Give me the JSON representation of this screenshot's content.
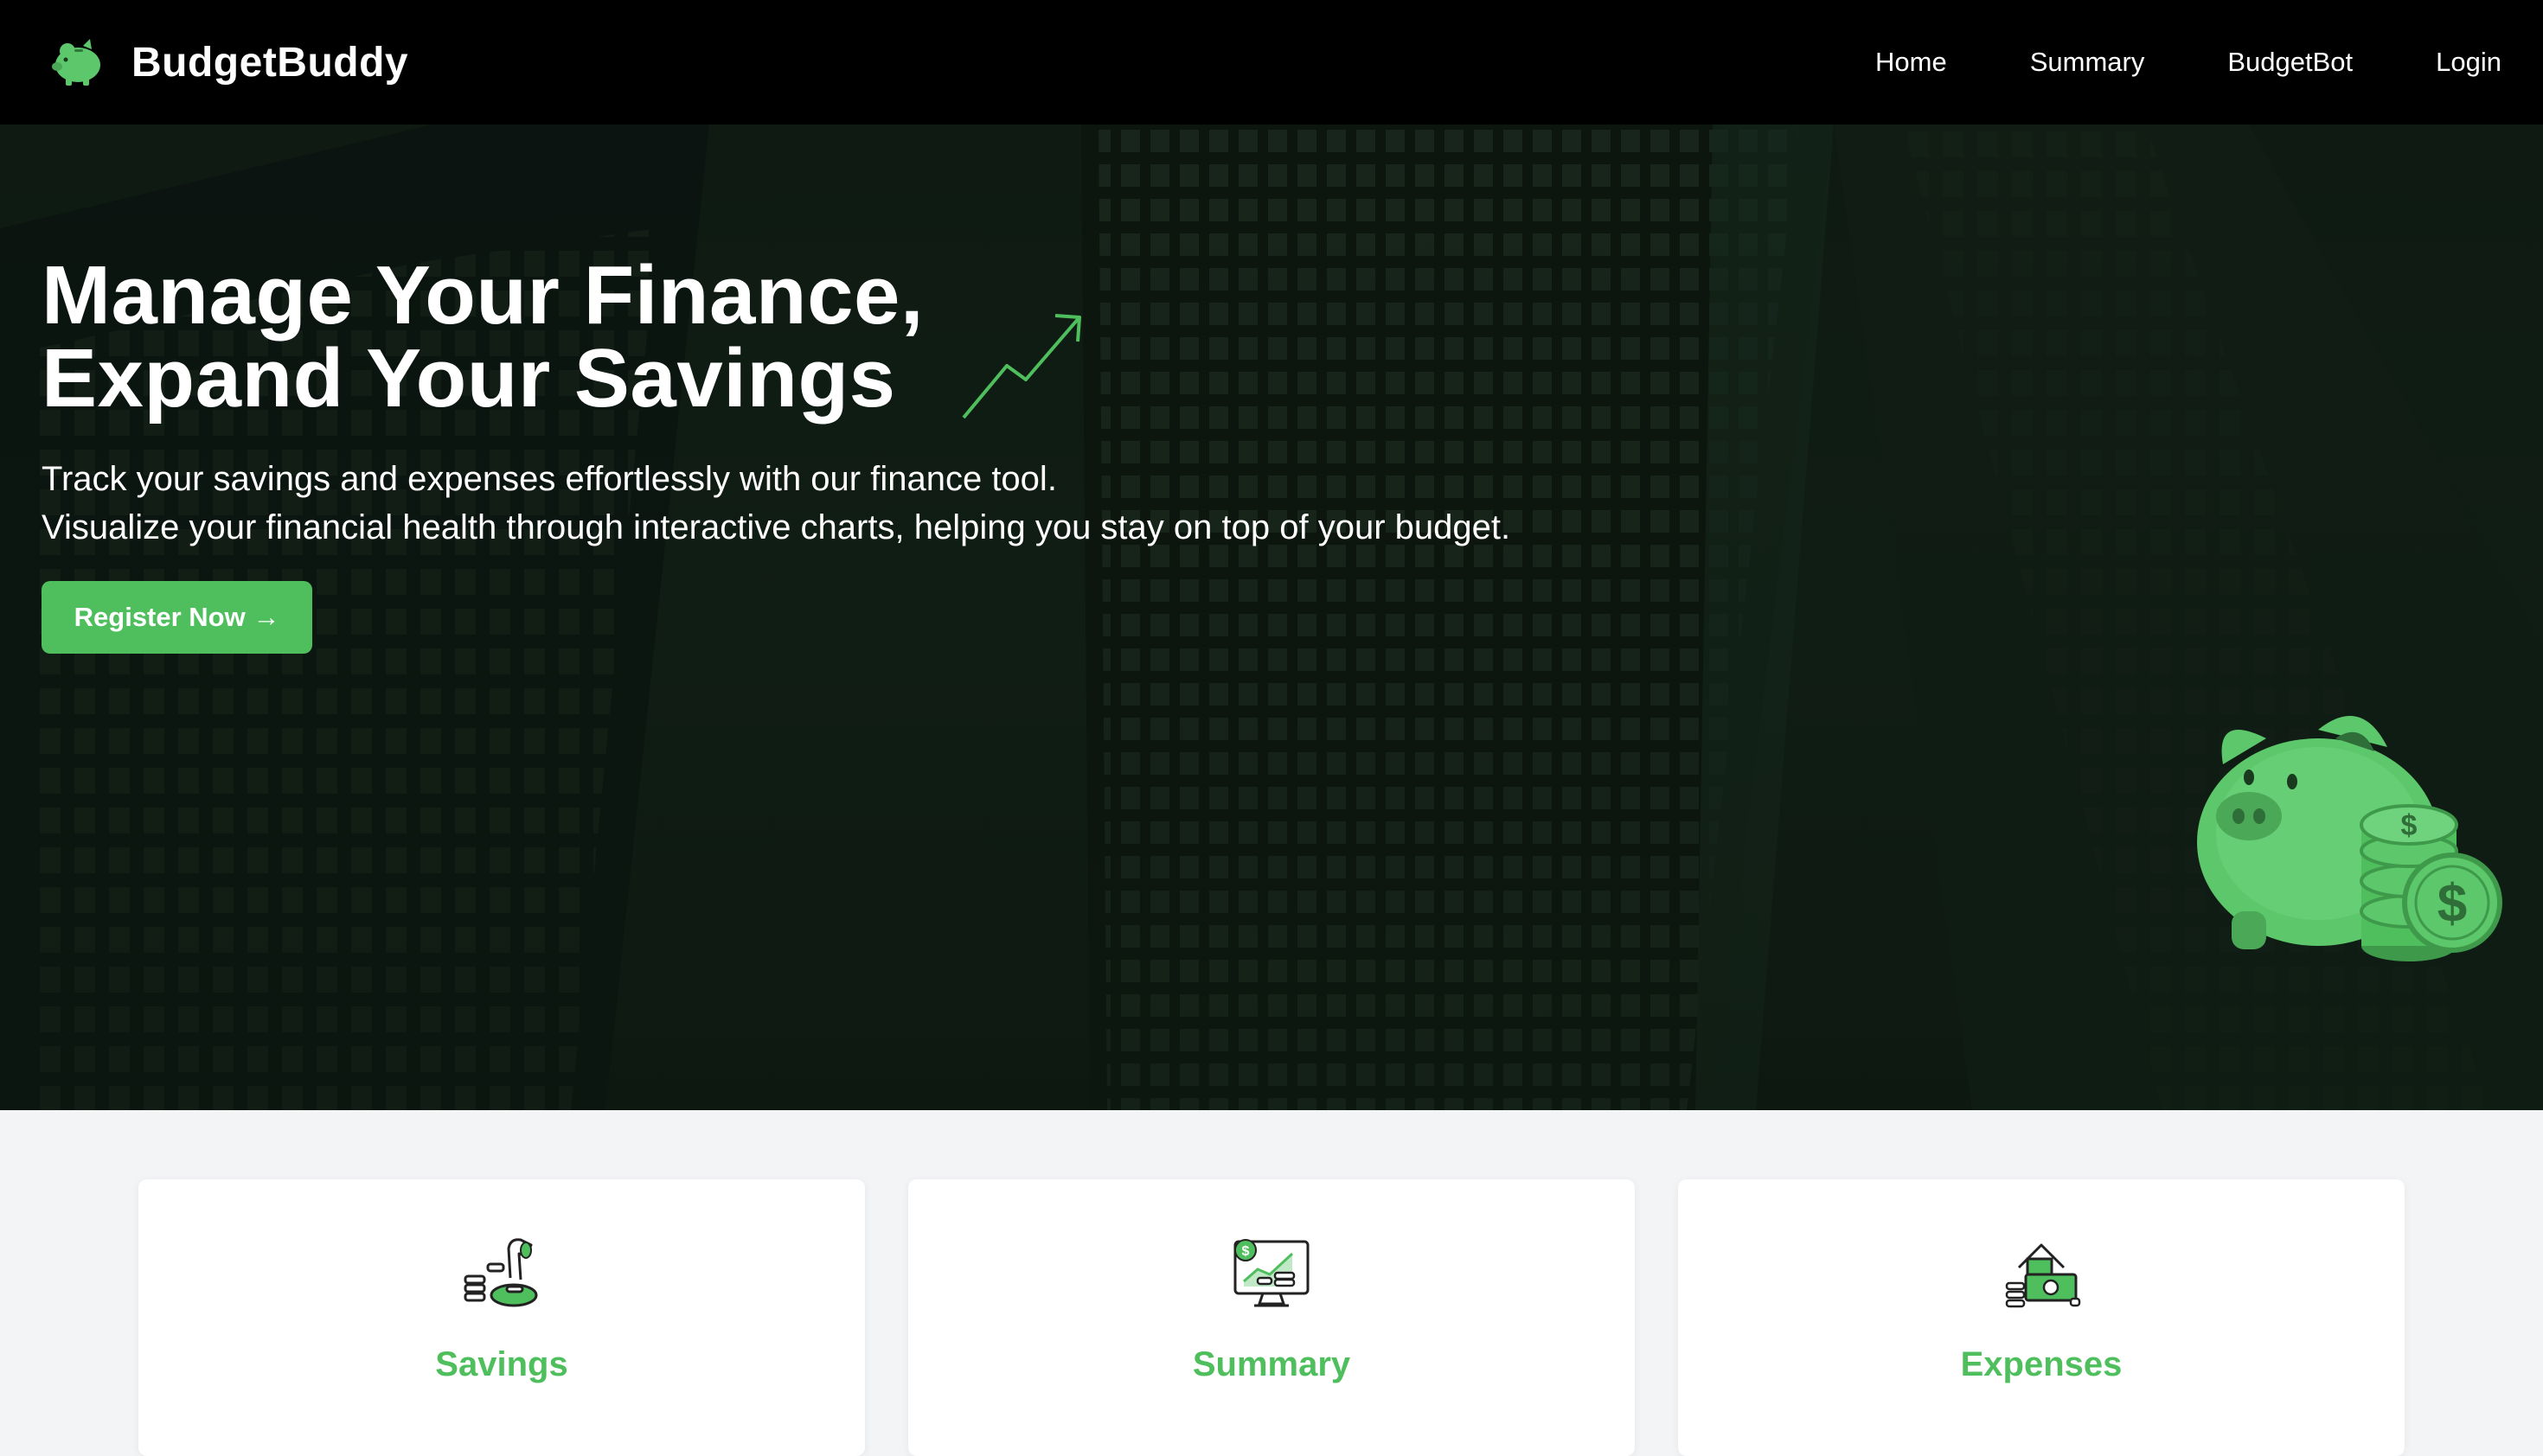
{
  "colors": {
    "accent": "#4fbf5e",
    "navbar": "#000000",
    "hero_bg": "#0e1a12",
    "page_bg": "#f3f4f6"
  },
  "brand": {
    "name": "BudgetBuddy",
    "logo_icon": "piggy-bank-icon"
  },
  "nav": {
    "items": [
      {
        "label": "Home"
      },
      {
        "label": "Summary"
      },
      {
        "label": "BudgetBot"
      },
      {
        "label": "Login"
      }
    ]
  },
  "hero": {
    "title": "Manage Your Finance,\nExpand Your Savings",
    "title_icon": "trend-up-arrow-icon",
    "subtitle_line1": "Track your savings and expenses effortlessly with our finance tool.",
    "subtitle_line2": "Visualize your financial health through interactive charts, helping you stay on top of your budget.",
    "cta_label": "Register Now →",
    "illustration": "piggy-bank-with-coins-icon"
  },
  "features": [
    {
      "title": "Savings",
      "icon": "savings-coins-icon"
    },
    {
      "title": "Summary",
      "icon": "summary-monitor-chart-icon"
    },
    {
      "title": "Expenses",
      "icon": "expenses-cash-house-icon"
    }
  ]
}
